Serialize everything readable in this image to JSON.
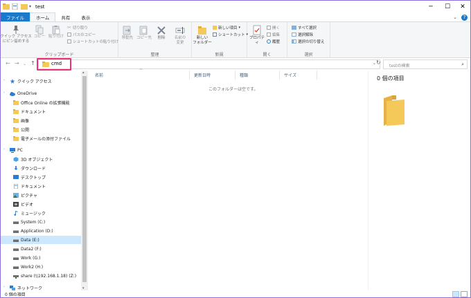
{
  "window": {
    "title": "test"
  },
  "tabs": {
    "file": "ファイル",
    "home": "ホーム",
    "share": "共有",
    "view": "表示"
  },
  "ribbon": {
    "clipboard": {
      "label": "クリップボード",
      "pin": "クイック アクセス\nにピン留めする",
      "copy": "コピー",
      "paste": "貼り付け",
      "cut": "切り取り",
      "copy_path": "パスのコピー",
      "paste_shortcut": "ショートカットの貼り付け"
    },
    "organize": {
      "label": "整理",
      "move_to": "移動先",
      "copy_to": "コピー先",
      "delete": "削除",
      "rename": "名前の\n変更"
    },
    "new": {
      "label": "新規",
      "new_folder": "新しい\nフォルダー",
      "new_item": "新しい項目",
      "shortcut": "ショートカット"
    },
    "open": {
      "label": "開く",
      "properties": "プロパティ",
      "open": "開く",
      "edit": "編集",
      "history": "履歴"
    },
    "select": {
      "label": "選択",
      "select_all": "すべて選択",
      "select_none": "選択解除",
      "invert": "選択の切り替え"
    }
  },
  "address": {
    "path": "cmd",
    "search_placeholder": "testの検索"
  },
  "nav": {
    "items": [
      {
        "label": "クイック アクセス",
        "icon": "star-icon"
      },
      {
        "label": "OneDrive",
        "icon": "cloud-icon"
      },
      {
        "label": "Office Online の拡張機能",
        "icon": "folder-icon"
      },
      {
        "label": "ドキュメント",
        "icon": "folder-icon"
      },
      {
        "label": "画像",
        "icon": "folder-icon"
      },
      {
        "label": "公開",
        "icon": "folder-icon"
      },
      {
        "label": "電子メールの添付ファイル",
        "icon": "folder-icon"
      },
      {
        "label": "PC",
        "icon": "pc-icon"
      },
      {
        "label": "3D オブジェクト",
        "icon": "cube-icon"
      },
      {
        "label": "ダウンロード",
        "icon": "download-icon"
      },
      {
        "label": "デスクトップ",
        "icon": "desktop-icon"
      },
      {
        "label": "ドキュメント",
        "icon": "document-icon"
      },
      {
        "label": "ピクチャ",
        "icon": "picture-icon"
      },
      {
        "label": "ビデオ",
        "icon": "video-icon"
      },
      {
        "label": "ミュージック",
        "icon": "music-icon"
      },
      {
        "label": "System (C:)",
        "icon": "drive-icon"
      },
      {
        "label": "Application (D:)",
        "icon": "drive-icon"
      },
      {
        "label": "Data (E:)",
        "icon": "drive-icon"
      },
      {
        "label": "Data2 (F:)",
        "icon": "drive-icon"
      },
      {
        "label": "Work (G:)",
        "icon": "drive-icon"
      },
      {
        "label": "Work2 (H:)",
        "icon": "drive-icon"
      },
      {
        "label": "share (\\\\192.168.1.18) (Z:)",
        "icon": "network-drive-icon"
      },
      {
        "label": "ネットワーク",
        "icon": "network-icon"
      }
    ]
  },
  "columns": {
    "name": "名前",
    "date": "更新日時",
    "type": "種類",
    "size": "サイズ"
  },
  "content": {
    "empty_message": "このフォルダーは空です。"
  },
  "details": {
    "title": "0 個の項目"
  },
  "status": {
    "text": "0 個の項目"
  },
  "colors": {
    "accent": "#1979ca",
    "highlight": "#e8337a",
    "selection": "#cce8ff",
    "folder": "#f5c85a"
  }
}
